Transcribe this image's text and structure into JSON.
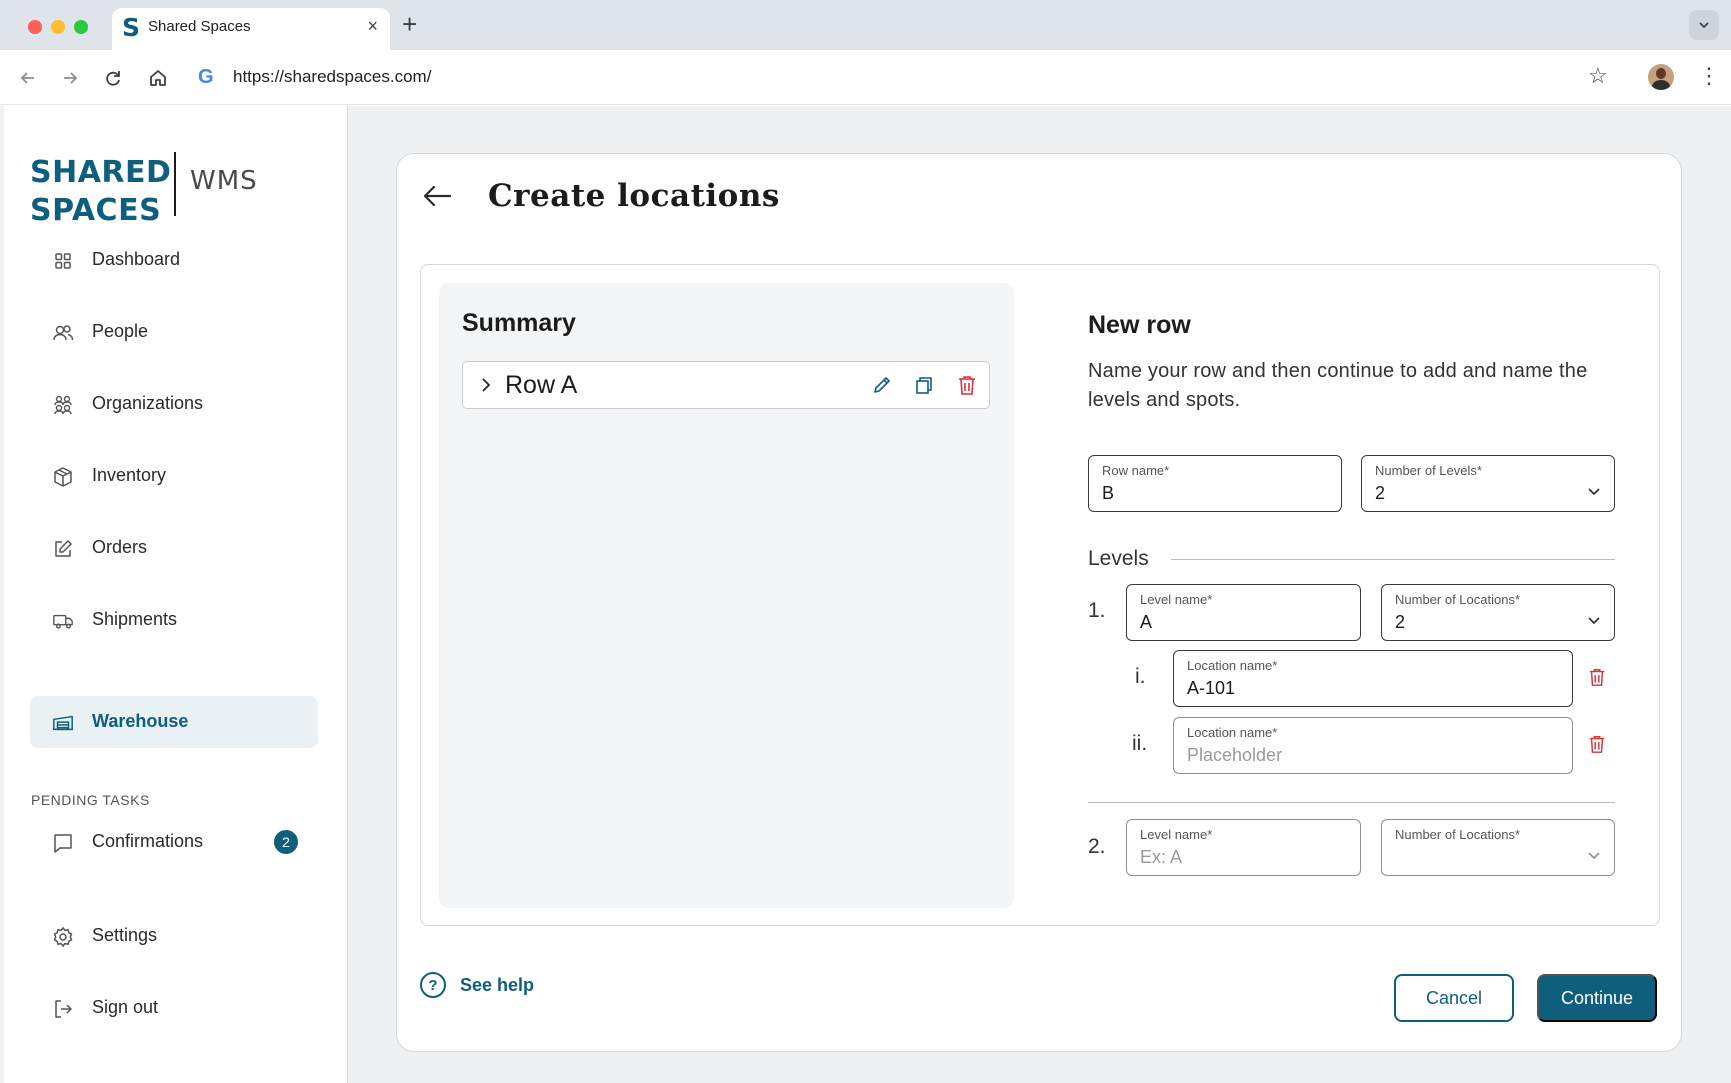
{
  "browser": {
    "tab_title": "Shared Spaces",
    "tab_favicon": "S",
    "tab_close": "×",
    "new_tab": "+",
    "url": "https://sharedspaces.com/",
    "search_engine_glyph": "G"
  },
  "app": {
    "logo_line1": "SHARED",
    "logo_line2": "SPACES",
    "logo_product": "WMS",
    "brand_color": "#0e5e7e"
  },
  "sidebar": {
    "items": [
      {
        "label": "Dashboard",
        "icon": "grid-icon"
      },
      {
        "label": "People",
        "icon": "people-icon"
      },
      {
        "label": "Organizations",
        "icon": "organizations-icon"
      },
      {
        "label": "Inventory",
        "icon": "box-icon"
      },
      {
        "label": "Orders",
        "icon": "edit-icon"
      },
      {
        "label": "Shipments",
        "icon": "truck-icon"
      },
      {
        "label": "Warehouse",
        "icon": "warehouse-icon",
        "active": true
      }
    ],
    "pending_section": "PENDING TASKS",
    "confirmations": {
      "label": "Confirmations",
      "badge": "2",
      "icon": "chat-icon"
    },
    "settings": {
      "label": "Settings",
      "icon": "gear-icon"
    },
    "sign_out": {
      "label": "Sign out",
      "icon": "sign-out-icon"
    }
  },
  "main": {
    "title": "Create locations",
    "summary": {
      "title": "Summary",
      "rows": [
        {
          "label": "Row A"
        }
      ]
    },
    "new_row": {
      "title": "New row",
      "description": "Name your row and then continue to add and name the levels and spots.",
      "row_name": {
        "label": "Row name*",
        "value": "B"
      },
      "number_of_levels": {
        "label": "Number of Levels*",
        "value": "2"
      },
      "levels_label": "Levels",
      "levels": [
        {
          "number": "1.",
          "level_name": {
            "label": "Level name*",
            "value": "A"
          },
          "number_of_locations": {
            "label": "Number of Locations*",
            "value": "2"
          },
          "locations": [
            {
              "number": "i.",
              "label": "Location name*",
              "value": "A-101",
              "placeholder": ""
            },
            {
              "number": "ii.",
              "label": "Location name*",
              "value": "",
              "placeholder": "Placeholder"
            }
          ]
        },
        {
          "number": "2.",
          "level_name": {
            "label": "Level name*",
            "value": "",
            "placeholder": "Ex: A"
          },
          "number_of_locations": {
            "label": "Number of Locations*",
            "value": ""
          }
        }
      ]
    },
    "help_label": "See help",
    "cancel_label": "Cancel",
    "continue_label": "Continue"
  }
}
